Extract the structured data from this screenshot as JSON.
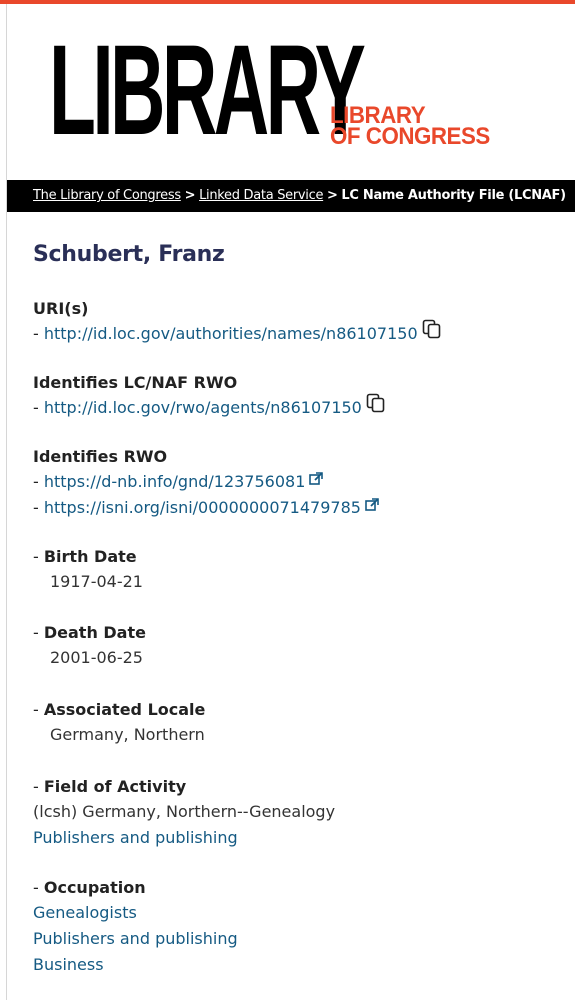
{
  "logo": {
    "main": "LIBRARY",
    "line1": "LIBRARY",
    "line2": "OF CONGRESS"
  },
  "breadcrumb": {
    "items": [
      "The Library of Congress",
      "Linked Data Service"
    ],
    "current": "LC Name Authority File (LCNAF)",
    "separator": ">"
  },
  "title": "Schubert, Franz",
  "uris": {
    "label": "URI(s)",
    "items": [
      "http://id.loc.gov/authorities/names/n86107150"
    ]
  },
  "identifies_lcnaf_rwo": {
    "label": "Identifies LC/NAF RWO",
    "items": [
      "http://id.loc.gov/rwo/agents/n86107150"
    ]
  },
  "identifies_rwo": {
    "label": "Identifies RWO",
    "items": [
      "https://d-nb.info/gnd/123756081",
      "https://isni.org/isni/0000000071479785"
    ]
  },
  "birth_date": {
    "label": "Birth Date",
    "value": "1917-04-21"
  },
  "death_date": {
    "label": "Death Date",
    "value": "2001-06-25"
  },
  "associated_locale": {
    "label": "Associated Locale",
    "value": "Germany, Northern"
  },
  "field_of_activity": {
    "label": "Field of Activity",
    "prefix": "(lcsh) Germany, Northern--Genealogy",
    "links": [
      "Publishers and publishing"
    ]
  },
  "occupation": {
    "label": "Occupation",
    "links": [
      "Genealogists",
      "Publishers and publishing",
      "Business"
    ]
  },
  "dash": "- ",
  "colors": {
    "accent": "#e9482b",
    "link": "#155a83",
    "heading": "#2a2f57"
  },
  "icons": {
    "copy": "copy-icon",
    "external": "external-link-icon"
  }
}
